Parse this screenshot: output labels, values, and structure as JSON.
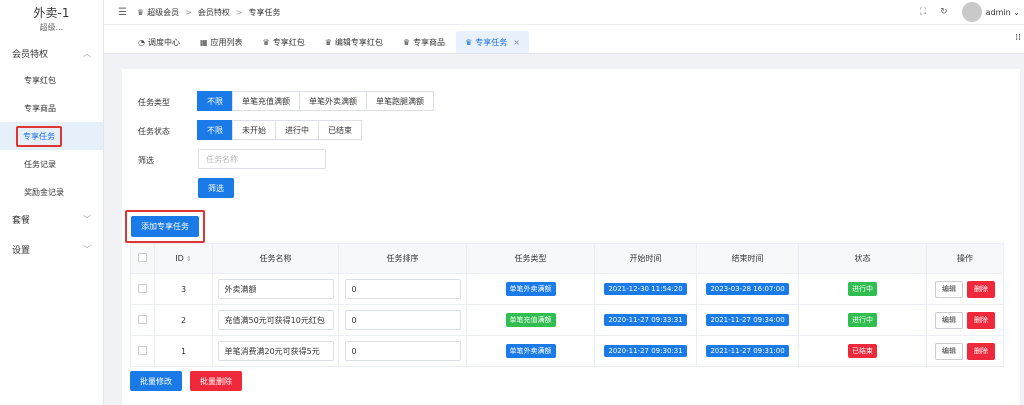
{
  "brand": {
    "title": "外卖-1",
    "subtitle": "超级..."
  },
  "sidebar": {
    "group1": "会员特权",
    "items": [
      "专享红包",
      "专享商品",
      "专享任务",
      "任务记录",
      "奖励金记录"
    ],
    "group2": "套餐",
    "group3": "设置"
  },
  "breadcrumb": [
    "超级会员",
    "会员特权",
    "专享任务"
  ],
  "user": "admin",
  "tabs": [
    "调度中心",
    "应用列表",
    "专享红包",
    "编辑专享红包",
    "专享商品",
    "专享任务"
  ],
  "filters": {
    "type_label": "任务类型",
    "type_options": [
      "不限",
      "单笔充值满额",
      "单笔外卖满额",
      "单笔跑腿满额"
    ],
    "status_label": "任务状态",
    "status_options": [
      "不限",
      "未开始",
      "进行中",
      "已结束"
    ],
    "filter_label": "筛选",
    "name_placeholder": "任务名称",
    "filter_button": "筛选"
  },
  "add_button": "添加专享任务",
  "table": {
    "headers": [
      "ID",
      "任务名称",
      "任务排序",
      "任务类型",
      "开始时间",
      "结束时间",
      "状态",
      "操作"
    ],
    "rows": [
      {
        "id": "3",
        "name": "外卖满额",
        "sort": "0",
        "type": "单笔外卖满额",
        "start": "2021-12-30 11:54:20",
        "end": "2023-03-28 16:07:00",
        "status": "进行中"
      },
      {
        "id": "2",
        "name": "充值满50元可获得10元红包",
        "sort": "0",
        "type": "单笔充值满额",
        "start": "2020-11-27 09:33:31",
        "end": "2021-11-27 09:34:00",
        "status": "进行中"
      },
      {
        "id": "1",
        "name": "单笔消费满20元可获得5元",
        "sort": "0",
        "type": "单笔外卖满额",
        "start": "2020-11-27 09:30:31",
        "end": "2021-11-27 09:31:00",
        "status": "已结束"
      }
    ],
    "edit_label": "编辑",
    "delete_label": "删除"
  },
  "bulk": {
    "edit": "批量修改",
    "delete": "批量删除"
  },
  "colors": {
    "primary": "#1a7ae8",
    "danger": "#f0283c",
    "success": "#2fbe4f",
    "highlight": "#e03535"
  }
}
